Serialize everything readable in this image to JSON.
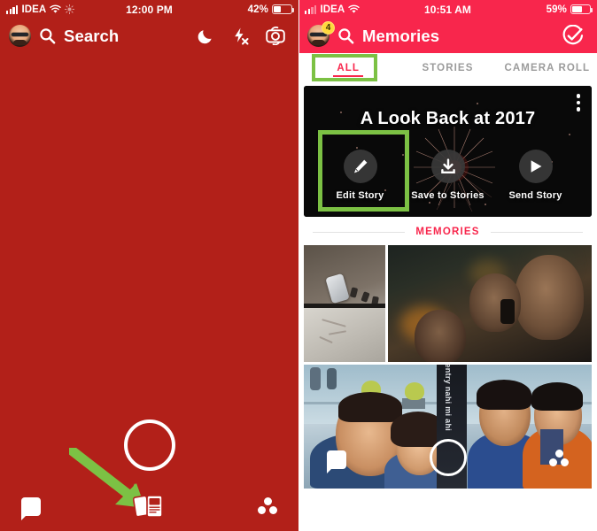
{
  "left": {
    "status": {
      "carrier": "IDEA",
      "time": "12:00 PM",
      "battery_pct": "42%",
      "battery_level": 42
    },
    "header": {
      "title": "Search",
      "search_icon": "search-icon",
      "avatar": "bitmoji-avatar"
    },
    "icons": {
      "night_mode": "moon-icon",
      "flash_off": "flash-off-icon",
      "flip_camera": "camera-flip-icon"
    },
    "bottom": {
      "chat": "chat-icon",
      "shutter": "shutter-button",
      "memories": "memories-cards-icon",
      "discover": "discover-icon"
    },
    "annotation": {
      "arrow": "green-arrow-pointing-to-memories",
      "color": "#7cc144"
    },
    "background_color": "#b22019"
  },
  "right": {
    "status": {
      "carrier": "IDEA",
      "time": "10:51 AM",
      "battery_pct": "59%",
      "battery_level": 59
    },
    "header": {
      "title": "Memories",
      "search_icon": "search-icon",
      "avatar": "bitmoji-avatar",
      "badge": "4",
      "select_icon": "check-circle-icon"
    },
    "header_color": "#f8264c",
    "tabs": [
      {
        "label": "ALL",
        "active": true,
        "highlighted": true
      },
      {
        "label": "STORIES",
        "active": false,
        "highlighted": false
      },
      {
        "label": "CAMERA ROLL",
        "active": false,
        "highlighted": false
      }
    ],
    "card": {
      "title": "A Look Back at 2017",
      "menu_icon": "kebab-menu-icon",
      "actions": [
        {
          "label": "Edit Story",
          "icon": "pencil-icon",
          "highlighted": true
        },
        {
          "label": "Save to Stories",
          "icon": "download-icon",
          "highlighted": false
        },
        {
          "label": "Send Story",
          "icon": "send-arrow-icon",
          "highlighted": false
        }
      ]
    },
    "section": {
      "label": "MEMORIES",
      "color": "#f8264c"
    },
    "memories": [
      {
        "name": "aerial-street-photo",
        "caption": ""
      },
      {
        "name": "night-group-selfie",
        "caption": ""
      },
      {
        "name": "group-of-four-photo",
        "caption": "Kahi entry nahi mi ahi"
      }
    ],
    "overlay_bar": {
      "chat": "chat-icon",
      "shutter": "shutter-button",
      "discover": "discover-icon"
    },
    "highlight_color": "#7cc144"
  }
}
